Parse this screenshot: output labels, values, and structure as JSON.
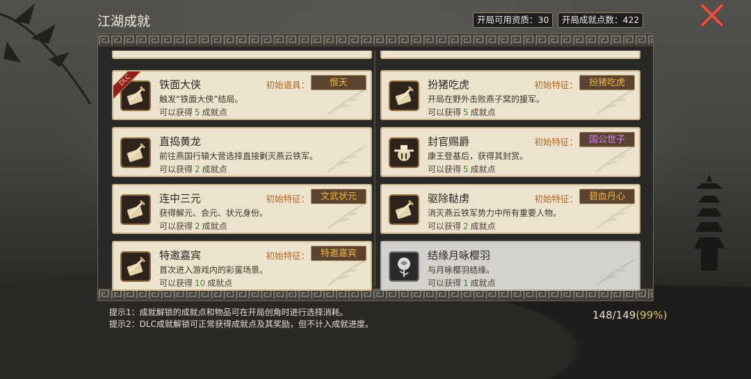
{
  "header": {
    "title": "江湖成就",
    "available_resources_label": "开局可用资质：30",
    "achievement_points_label": "开局成就点数：422"
  },
  "cards": [
    {
      "name": "铁面大侠",
      "desc": "触发“铁面大侠”结局。",
      "reward_prefix": "可以获得",
      "points": "5",
      "reward_suffix": "成就点",
      "reward_type": "初始道具：",
      "tag": "恨天",
      "tag_color": "#f0b54a",
      "dlc": "DLC",
      "icon": "scroll-sword-icon"
    },
    {
      "name": "扮猪吃虎",
      "desc": "开局在野外击败燕子窝的援军。",
      "reward_prefix": "可以获得",
      "points": "5",
      "reward_suffix": "成就点",
      "reward_type": "初始特征：",
      "tag": "扮猪吃虎",
      "tag_color": "#f0b54a",
      "icon": "scroll-sword-icon"
    },
    {
      "name": "直捣黄龙",
      "desc": "前往燕国行辕大营选择直接剿灭燕云铁军。",
      "reward_prefix": "可以获得",
      "points": "2",
      "reward_suffix": "成就点",
      "icon": "scroll-sword-icon"
    },
    {
      "name": "封官赐爵",
      "desc": "康王登基后，获得其封赏。",
      "reward_prefix": "可以获得",
      "points": "5",
      "reward_suffix": "成就点",
      "reward_type": "初始特征：",
      "tag": "国公世子",
      "tag_color": "#d980f5",
      "icon": "official-hat-icon"
    },
    {
      "name": "连中三元",
      "desc": "获得解元、会元、状元身份。",
      "reward_prefix": "可以获得",
      "points": "2",
      "reward_suffix": "成就点",
      "reward_type": "初始特征：",
      "tag": "文武状元",
      "tag_color": "#f0b54a",
      "icon": "scroll-sword-icon"
    },
    {
      "name": "驱除鞑虏",
      "desc": "消灭燕云铁军势力中所有重要人物。",
      "reward_prefix": "可以获得",
      "points": "2",
      "reward_suffix": "成就点",
      "reward_type": "初始特征：",
      "tag": "碧血丹心",
      "tag_color": "#f0b54a",
      "icon": "scroll-sword-icon"
    },
    {
      "name": "特邀嘉宾",
      "desc": "首次进入游戏内的彩蛋场景。",
      "reward_prefix": "可以获得",
      "points": "10",
      "reward_suffix": "成就点",
      "reward_type": "初始特征：",
      "tag": "特邀嘉宾",
      "tag_color": "#f0b54a",
      "icon": "scroll-sword-icon"
    },
    {
      "name": "结缘月咏樱羽",
      "desc": "与月咏樱羽结缘。",
      "reward_prefix": "可以获得",
      "points": "1",
      "reward_suffix": "成就点",
      "icon": "rose-icon",
      "state": "grey"
    }
  ],
  "footer": {
    "hint1": "提示1：成就解锁的成就点和物品可在开局创角时进行选择消耗。",
    "hint2": "提示2：DLC成就解锁可正常获得成就点及其奖励，但不计入成就进度。",
    "progress_count": "148/149",
    "progress_pct": "(99%)"
  }
}
